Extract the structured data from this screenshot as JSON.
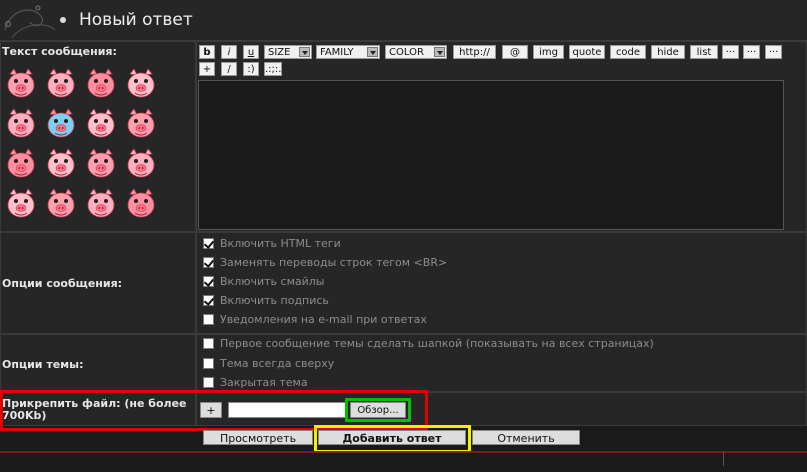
{
  "header": {
    "title": "Новый ответ"
  },
  "form": {
    "message_label": "Текст сообщения:",
    "options_label": "Опции сообщения:",
    "topic_label": "Опции темы:",
    "attach_label": "Прикрепить файл: (не более 700Kb)"
  },
  "toolbar": {
    "bold": "b",
    "italic": "i",
    "underline": "u",
    "size": "SIZE",
    "family": "FAMILY",
    "color": "COLOR",
    "http": "http://",
    "at": "@",
    "img": "img",
    "quote": "quote",
    "code": "code",
    "hide": "hide",
    "list": "list",
    "more1": "···",
    "more2": "···",
    "more3": "···",
    "plus": "+",
    "slash": "/",
    "smile": ":)",
    "dots": ".:;:."
  },
  "message_options": [
    {
      "label": "Включить HTML теги",
      "checked": true
    },
    {
      "label": "Заменять переводы строк тегом <BR>",
      "checked": true
    },
    {
      "label": "Включить смайлы",
      "checked": true
    },
    {
      "label": "Включить подпись",
      "checked": true
    },
    {
      "label": "Уведомления на e-mail при ответах",
      "checked": false
    }
  ],
  "topic_options": [
    {
      "label": "Первое сообщение темы сделать шапкой (показывать на всех страницах)",
      "checked": false
    },
    {
      "label": "Тема всегда сверху",
      "checked": false
    },
    {
      "label": "Закрытая тема",
      "checked": false
    }
  ],
  "attach": {
    "add": "+",
    "file_value": "",
    "browse": "Обзор..."
  },
  "buttons": {
    "preview": "Просмотреть",
    "submit": "Добавить ответ",
    "cancel": "Отменить"
  },
  "colors": {
    "highlight_red": "#e00000",
    "highlight_green": "#00c000",
    "highlight_yellow": "#f0f000"
  },
  "smiley_icons": [
    "pig-face-icon"
  ]
}
